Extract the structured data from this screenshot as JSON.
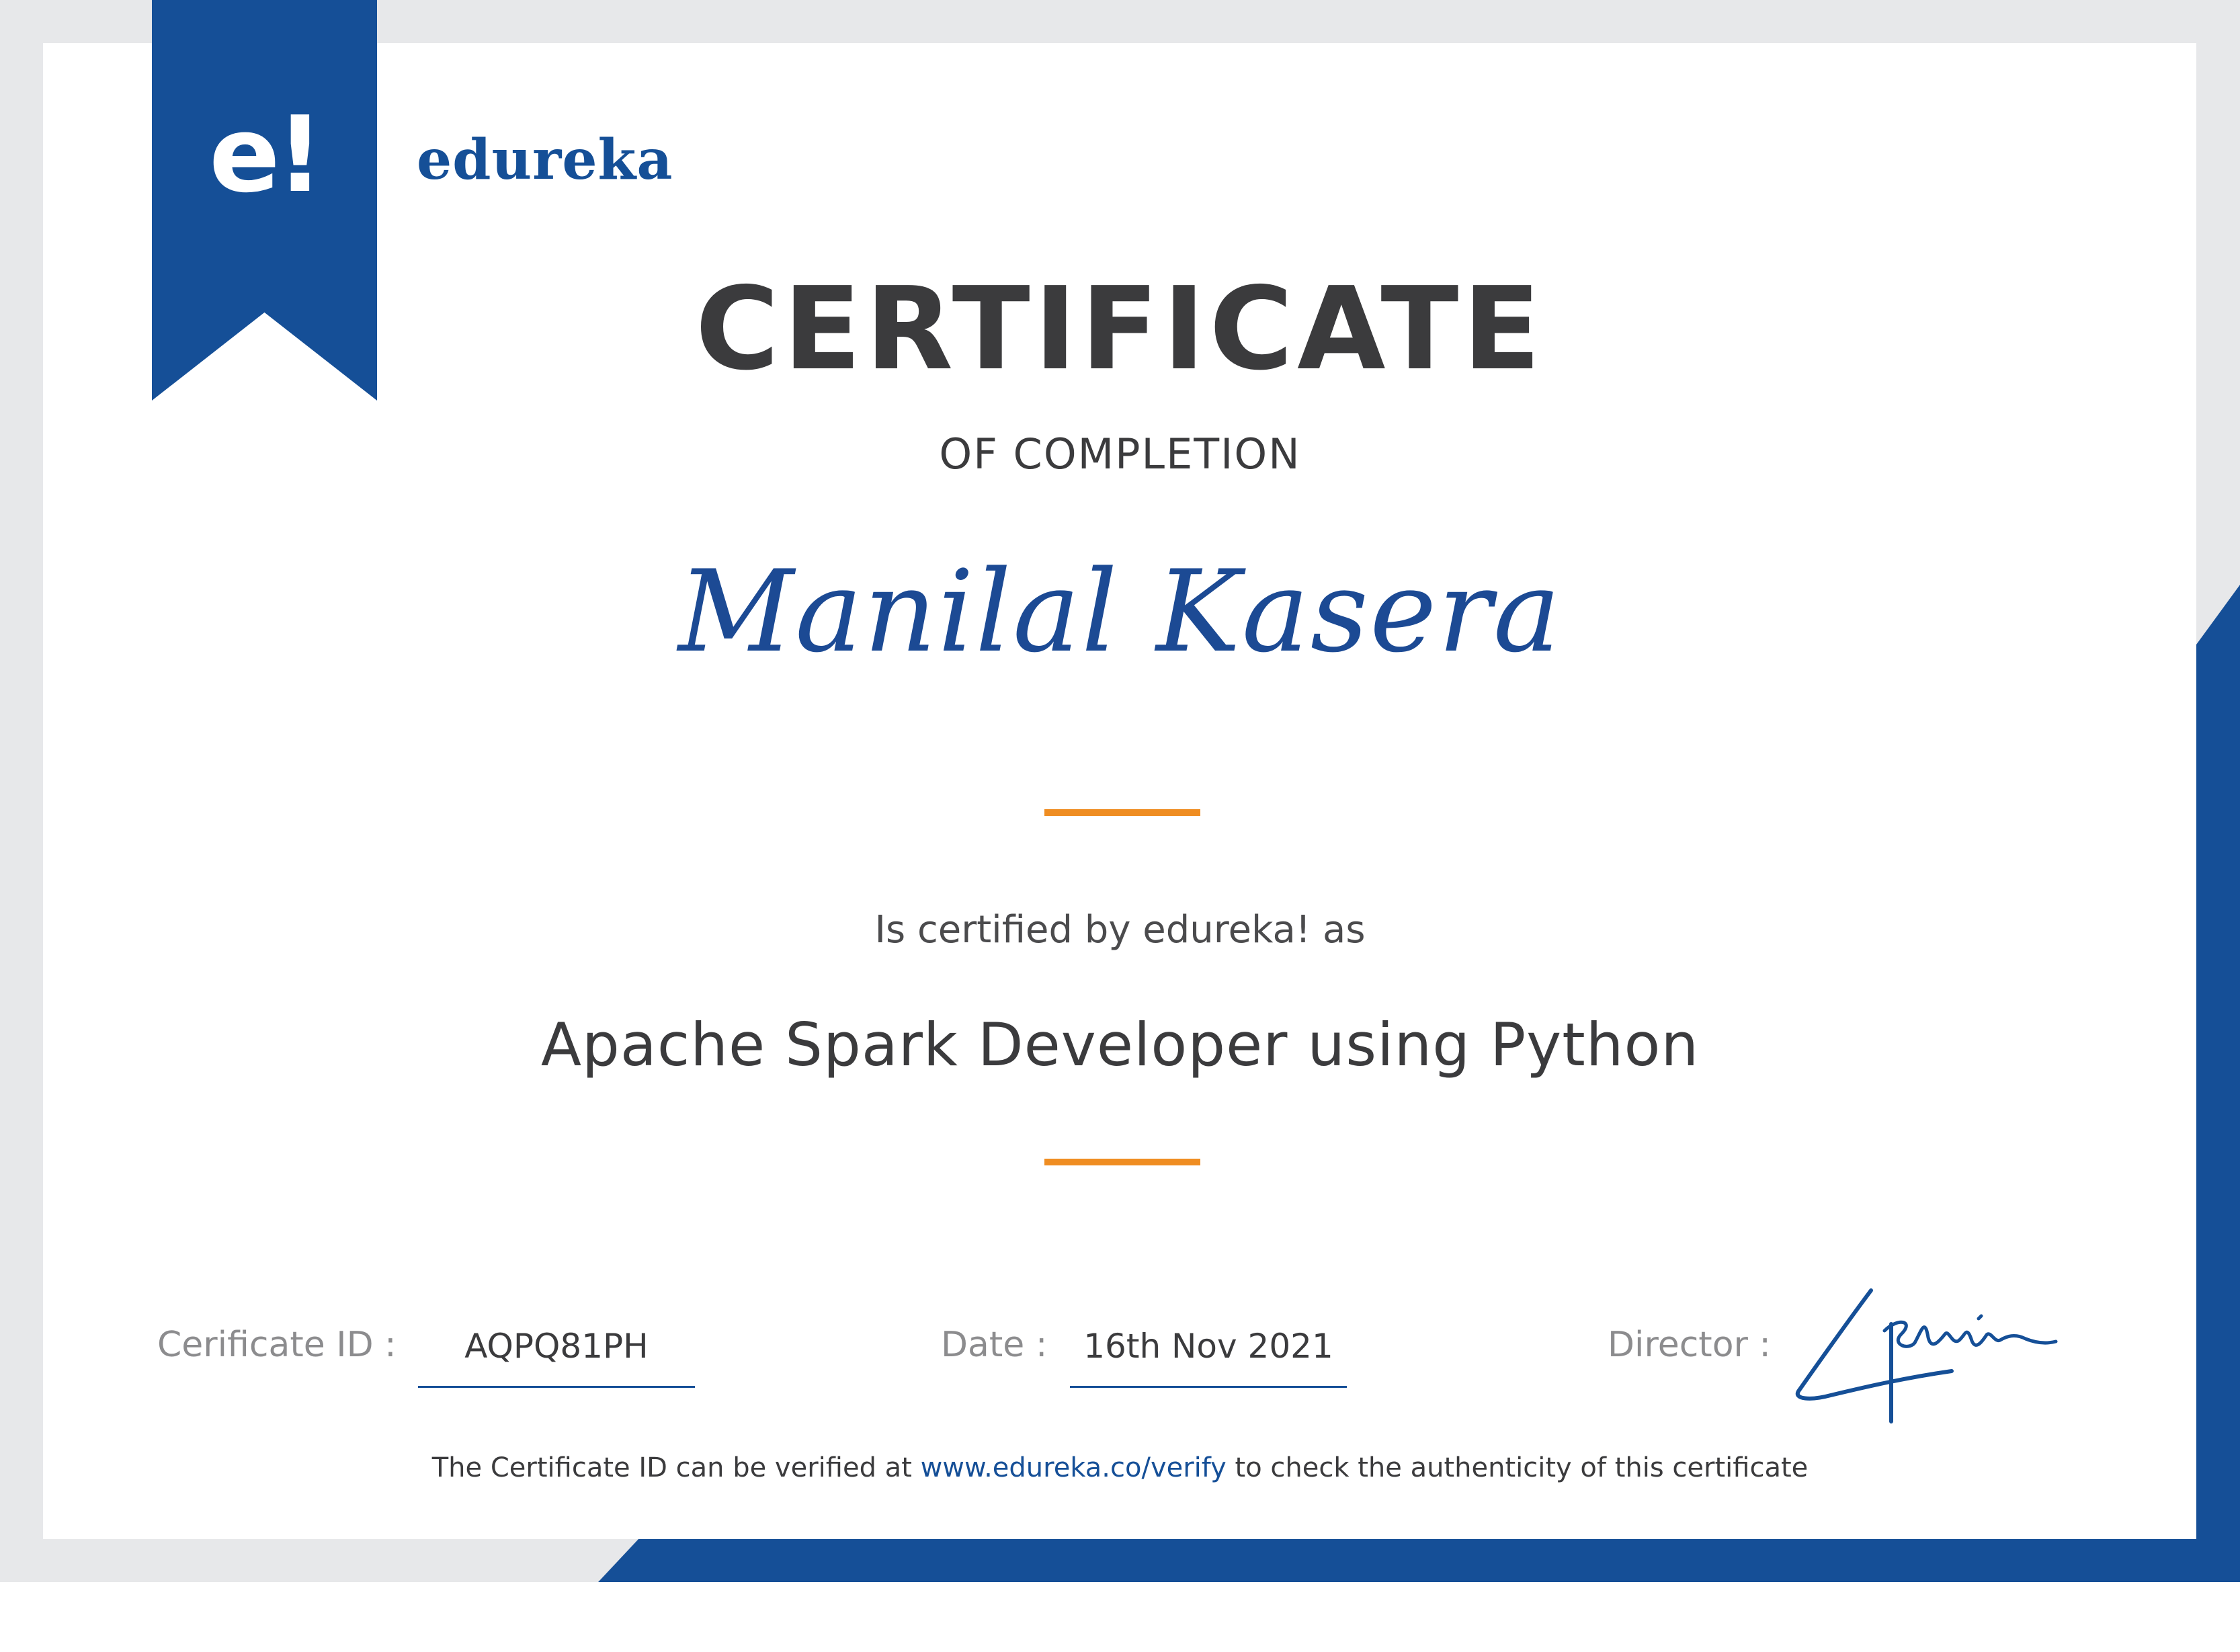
{
  "brand": {
    "logo_mark": "e!",
    "name": "edureka",
    "primary_color": "#154f97",
    "accent_color": "#ef8d22"
  },
  "certificate": {
    "title": "CERTIFICATE",
    "subtitle": "OF COMPLETION",
    "recipient_name": "Manilal Kasera",
    "certified_by_text": "Is certified by edureka! as",
    "course_title": "Apache Spark Developer using Python"
  },
  "details": {
    "certificate_id_label": "Cerificate ID :",
    "certificate_id_value": "AQPQ81PH",
    "date_label": "Date :",
    "date_value": "16th Nov 2021",
    "director_label": "Director :"
  },
  "footer": {
    "prefix": "The Certificate ID can be verified at",
    "link_text": "www.edureka.co/verify",
    "suffix": "to check the authenticity of this certificate"
  }
}
